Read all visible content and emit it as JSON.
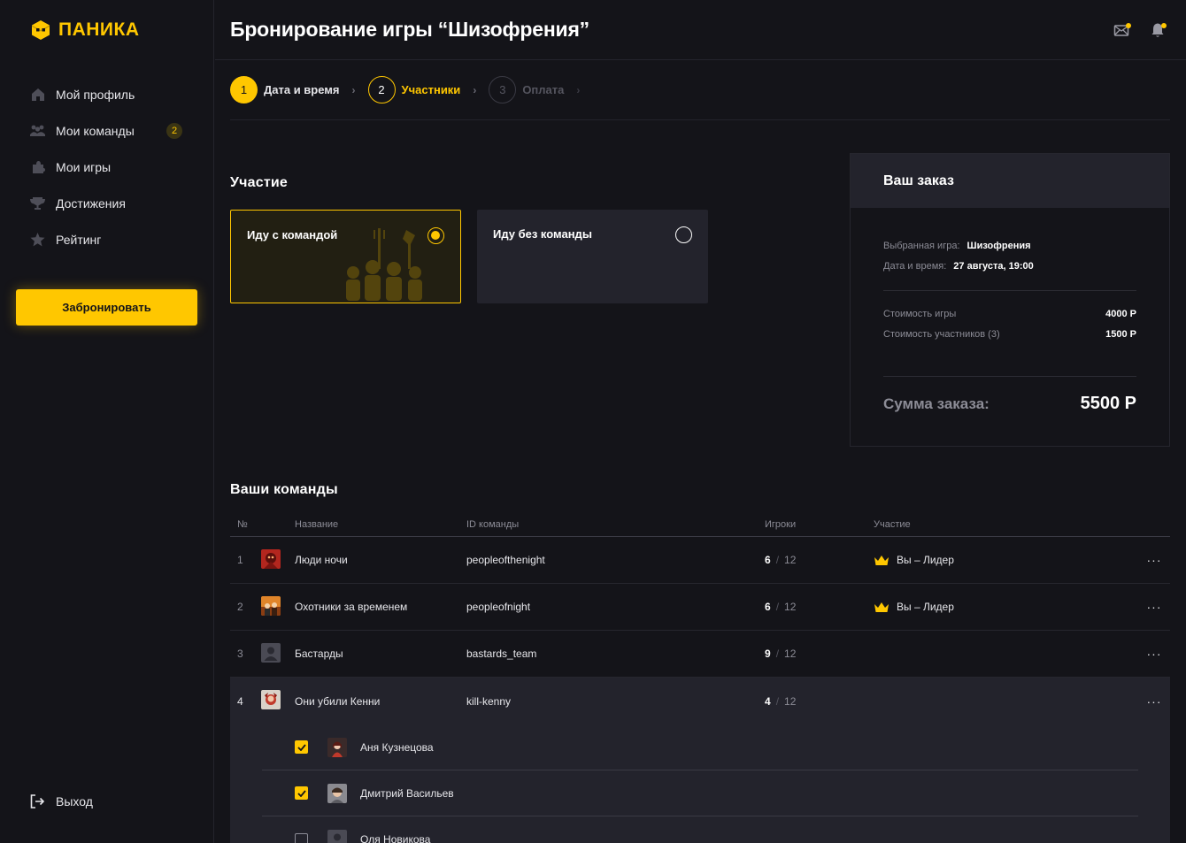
{
  "app": {
    "logo_text": "ПАНИКА"
  },
  "sidebar": {
    "items": [
      {
        "label": "Мой профиль",
        "icon": "home-icon"
      },
      {
        "label": "Мои команды",
        "icon": "team-icon",
        "badge": "2"
      },
      {
        "label": "Мои игры",
        "icon": "puzzle-icon"
      },
      {
        "label": "Достижения",
        "icon": "trophy-icon"
      },
      {
        "label": "Рейтинг",
        "icon": "star-icon"
      }
    ],
    "book_button": "Забронировать",
    "logout_label": "Выход"
  },
  "header": {
    "title": "Бронирование игры “Шизофрения”"
  },
  "stepper": {
    "steps": [
      {
        "num": "1",
        "label": "Дата и время",
        "state": "done"
      },
      {
        "num": "2",
        "label": "Участники",
        "state": "active"
      },
      {
        "num": "3",
        "label": "Оплата",
        "state": "todo"
      }
    ]
  },
  "participation": {
    "title": "Участие",
    "options": [
      {
        "label": "Иду с командой",
        "selected": true
      },
      {
        "label": "Иду без команды",
        "selected": false
      }
    ]
  },
  "order": {
    "title": "Ваш заказ",
    "game_label": "Выбранная игра:",
    "game_value": "Шизофрения",
    "date_label": "Дата и время:",
    "date_value": "27 августа, 19:00",
    "cost_game_label": "Стоимость игры",
    "cost_game_value": "4000 Р",
    "cost_part_label": "Стоимость участников (3)",
    "cost_part_value": "1500 Р",
    "total_label": "Сумма заказа:",
    "total_value": "5500 Р"
  },
  "teams": {
    "title": "Ваши команды",
    "columns": {
      "num": "№",
      "name": "Название",
      "id": "ID команды",
      "players": "Игроки",
      "participation": "Участие"
    },
    "rows": [
      {
        "num": "1",
        "name": "Люди ночи",
        "id": "peopleofthenight",
        "players": "6",
        "max": "12",
        "role": "Вы – Лидер"
      },
      {
        "num": "2",
        "name": "Охотники за временем",
        "id": "peopleofnight",
        "players": "6",
        "max": "12",
        "role": "Вы – Лидер"
      },
      {
        "num": "3",
        "name": "Бастарды",
        "id": "bastards_team",
        "players": "9",
        "max": "12",
        "role": ""
      },
      {
        "num": "4",
        "name": "Они убили Кенни",
        "id": "kill-kenny",
        "players": "4",
        "max": "12",
        "role": ""
      }
    ],
    "separator": "/",
    "more": "···",
    "members": [
      {
        "name": "Аня Кузнецова",
        "checked": true
      },
      {
        "name": "Дмитрий Васильев",
        "checked": true
      },
      {
        "name": "Оля Новикова",
        "checked": false
      }
    ]
  },
  "colors": {
    "accent": "#ffc700",
    "background": "#141419",
    "panel": "#23232c"
  }
}
